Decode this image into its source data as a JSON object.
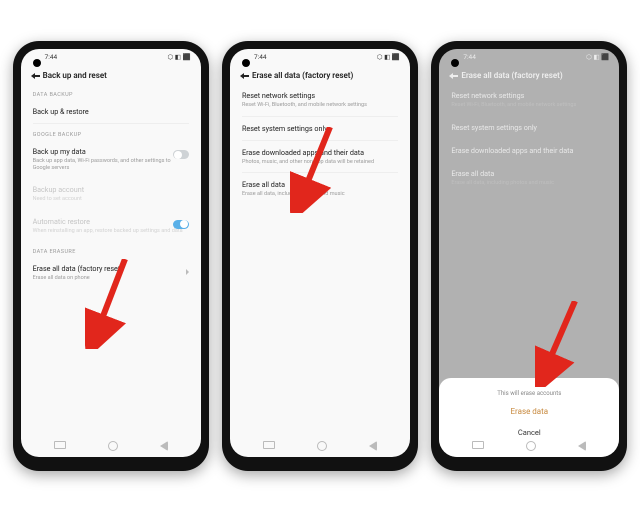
{
  "status": {
    "time": "7:44",
    "net": "⬝ ⬝",
    "right": "⬡  ◧  ⬛"
  },
  "phone1": {
    "title": "Back up and reset",
    "sec1": "DATA BACKUP",
    "i1": "Back up & restore",
    "sec2": "GOOGLE BACKUP",
    "i2t": "Back up my data",
    "i2s": "Back up app data, Wi-Fi passwords, and other settings to Google servers",
    "i3t": "Backup account",
    "i3s": "Need to set account",
    "i4t": "Automatic restore",
    "i4s": "When reinstalling an app, restore backed up settings and data",
    "sec3": "DATA ERASURE",
    "i5t": "Erase all data (factory reset)",
    "i5s": "Erase all data on phone"
  },
  "phone2": {
    "title": "Erase all data (factory reset)",
    "i1t": "Reset network settings",
    "i1s": "Reset Wi-Fi, Bluetooth, and mobile network settings",
    "i2t": "Reset system settings only",
    "i3t": "Erase downloaded apps and their data",
    "i3s": "Photos, music, and other non-app data will be retained",
    "i4t": "Erase all data",
    "i4s": "Erase all data, including photos and music"
  },
  "phone3": {
    "title": "Erase all data (factory reset)",
    "i1t": "Reset network settings",
    "i1s": "Reset Wi-Fi, Bluetooth, and mobile network settings",
    "i2t": "Reset system settings only",
    "i3t": "Erase downloaded apps and their data",
    "i4t": "Erase all data",
    "i4s": "Erase all data, including photos and music",
    "sheet_msg": "This will erase accounts",
    "sheet_action": "Erase data",
    "sheet_cancel": "Cancel"
  }
}
